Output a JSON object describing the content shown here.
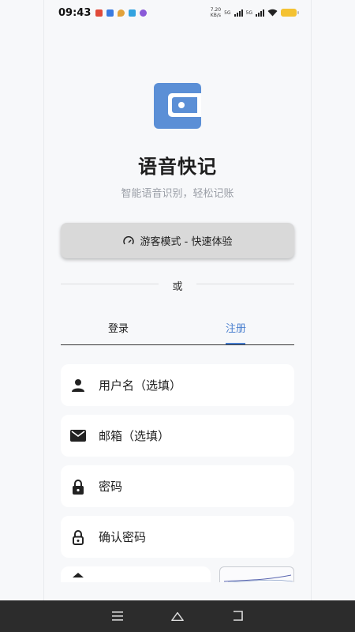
{
  "status": {
    "time": "09:43",
    "net_speed_value": "7.20",
    "net_speed_unit": "KB/s",
    "signal1": "5G",
    "signal2": "5G"
  },
  "app": {
    "title": "语音快记",
    "subtitle": "智能语音识别，轻松记账",
    "accent_color": "#4a7fcf"
  },
  "guest": {
    "icon": "speedometer-icon",
    "label": "游客模式 - 快速体验"
  },
  "divider": {
    "text": "或"
  },
  "tabs": [
    {
      "label": "登录",
      "active": false
    },
    {
      "label": "注册",
      "active": true
    }
  ],
  "form": {
    "username": {
      "icon": "person-icon",
      "placeholder": "用户名（选填）"
    },
    "email": {
      "icon": "mail-icon",
      "placeholder": "邮箱（选填）"
    },
    "password": {
      "icon": "lock-icon",
      "placeholder": "密码"
    },
    "confirm": {
      "icon": "lock-outline-icon",
      "placeholder": "确认密码"
    },
    "captcha": {
      "icon": "shield-icon"
    }
  },
  "nav": {
    "menu": "menu-icon",
    "home": "home-icon",
    "back": "back-icon"
  }
}
